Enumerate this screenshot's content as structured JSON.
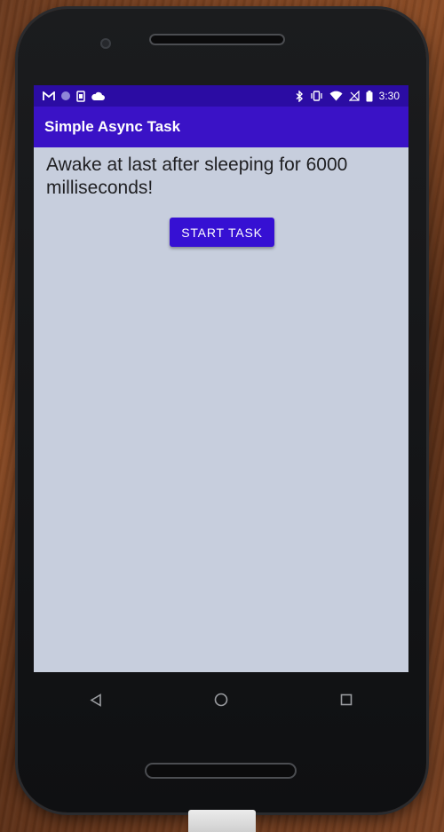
{
  "app": {
    "title": "Simple Async Task"
  },
  "statusbar": {
    "time": "3:30",
    "left_icons": [
      "gmail-icon",
      "circle-notification-icon",
      "sim-icon",
      "cloud-icon"
    ],
    "right_icons": [
      "bluetooth-icon",
      "vibrate-icon",
      "wifi-icon",
      "signal-off-icon",
      "battery-icon"
    ]
  },
  "main": {
    "message": "Awake at last after sleeping for 6000 milliseconds!",
    "start_button_label": "START TASK"
  },
  "navbar": {
    "buttons": [
      "back-icon",
      "home-icon",
      "recents-icon"
    ]
  },
  "colors": {
    "statusbar": "#2b0ca3",
    "appbar": "#3a12c6",
    "button": "#3610d3",
    "screen_bg": "#c7cedd"
  }
}
